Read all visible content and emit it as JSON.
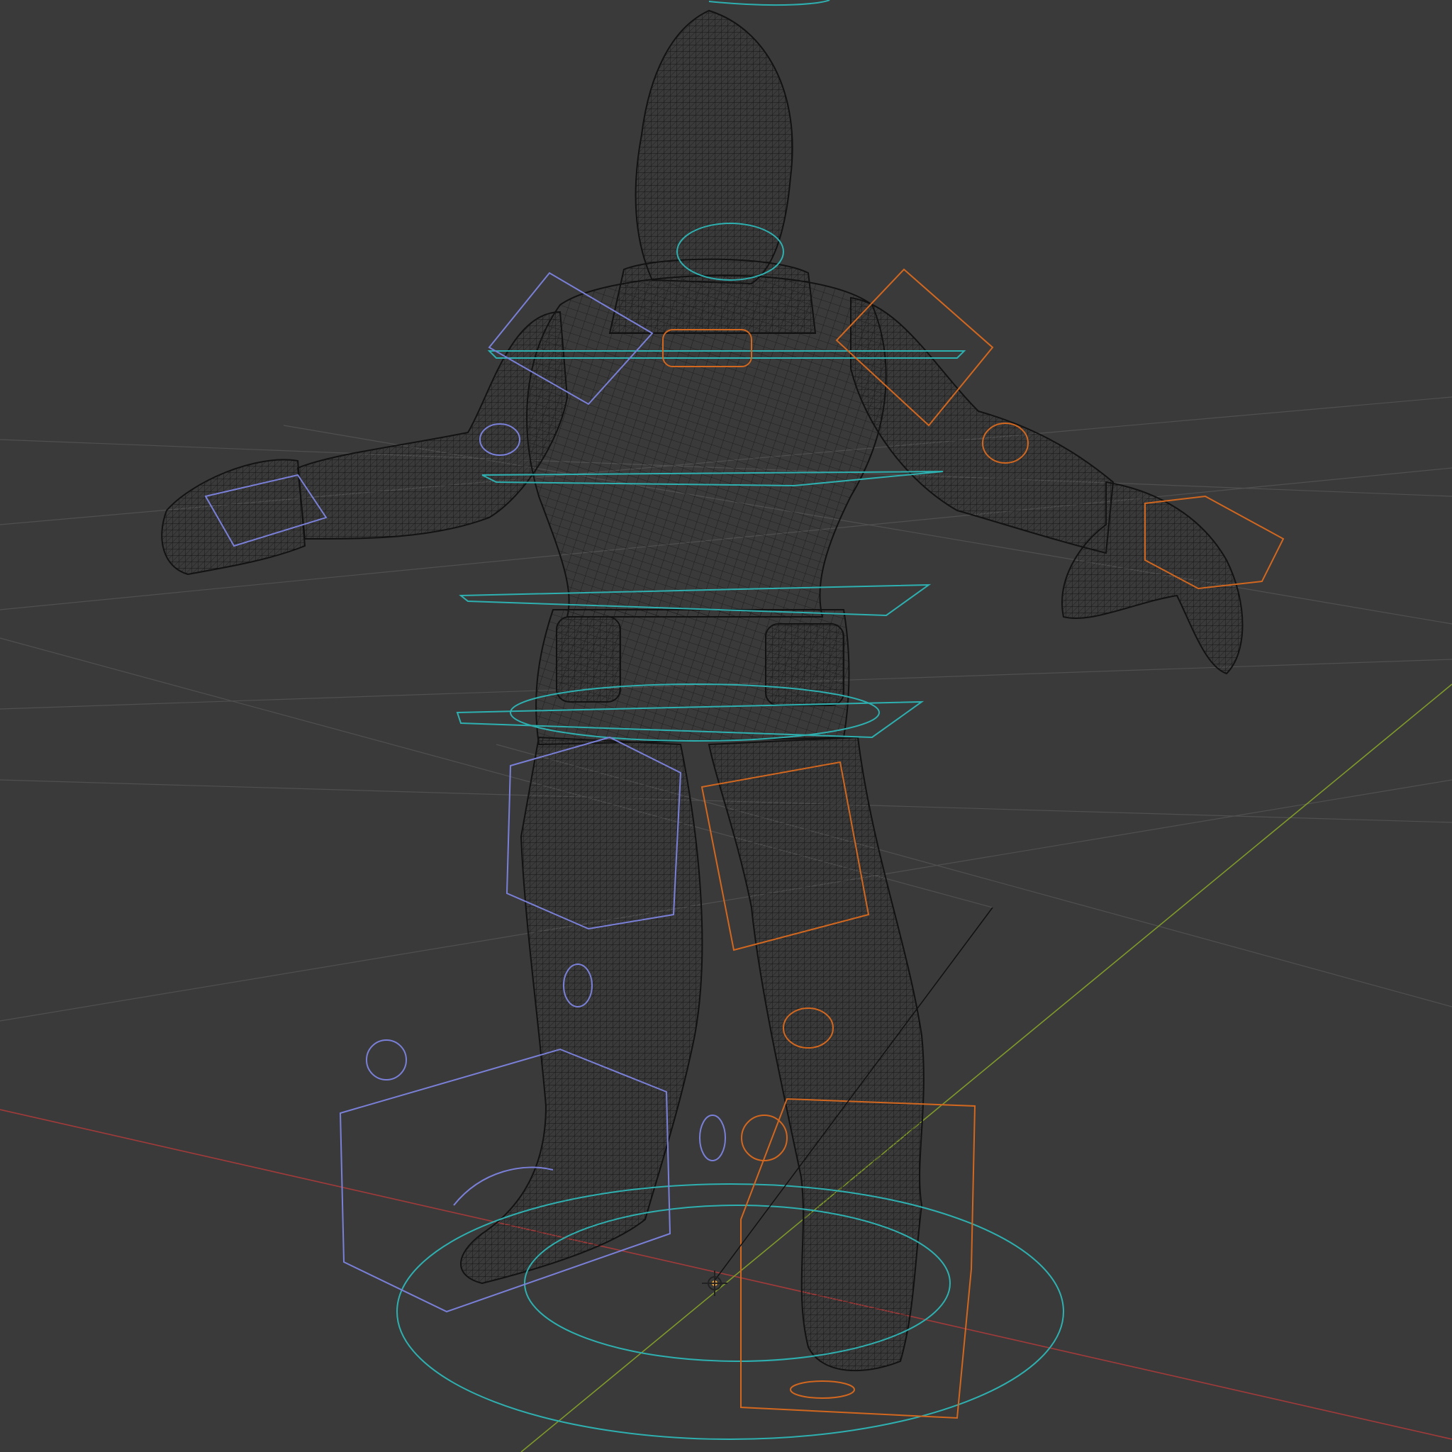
{
  "viewport": {
    "background": "#3a3a3a",
    "shading_mode": "wireframe",
    "view": "perspective"
  },
  "colors": {
    "grid_line": "#505050",
    "x_axis": "#a33a3a",
    "y_axis": "#7f9a2a",
    "mesh_wire": "#141414",
    "mesh_fill": "#2e2e2e",
    "control_cyan": "#2fb0b0",
    "control_left": "#7a80d8",
    "control_right": "#d2671f",
    "origin_dot": "#e8a030"
  },
  "scene": {
    "object": "character-mesh",
    "rig": "armature-controls",
    "icons": [
      "world-origin-icon",
      "pivot-gizmo-icon",
      "ik-target-icon"
    ]
  }
}
